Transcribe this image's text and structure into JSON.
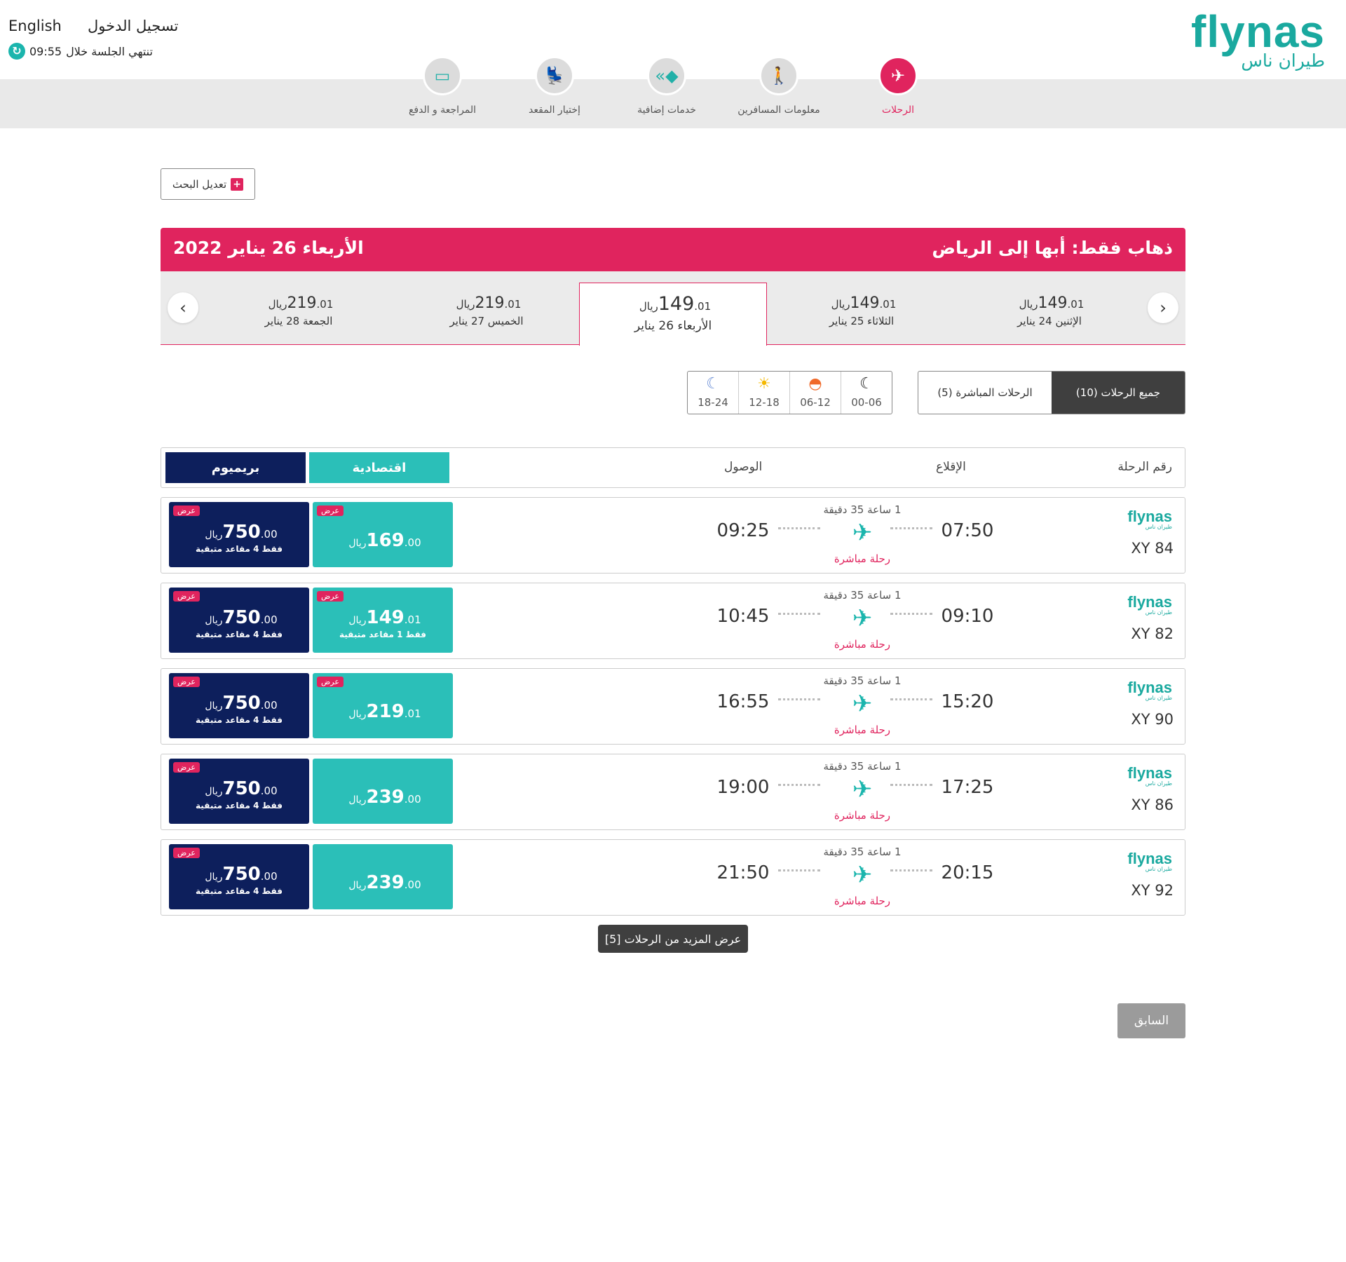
{
  "header": {
    "language_link": "English",
    "login_link": "تسجيل الدخول",
    "session_text": "تنتهي الجلسة خلال",
    "session_time": "09:55",
    "logo_en": "flynas",
    "logo_ar": "طيران ناس"
  },
  "steps": [
    {
      "label": "الرحلات",
      "icon": "plane-icon",
      "active": true
    },
    {
      "label": "معلومات المسافرين",
      "icon": "traveler-icon"
    },
    {
      "label": "خدمات إضافية",
      "icon": "extras-icon"
    },
    {
      "label": "إختيار المقعد",
      "icon": "seat-icon"
    },
    {
      "label": "المراجعة و الدفع",
      "icon": "payment-icon"
    }
  ],
  "modify_search": "تعديل البحث",
  "banner": {
    "route": "ذهاب فقط: أبها إلى الرياض",
    "date": "الأربعاء 26 يناير 2022"
  },
  "date_strip": [
    {
      "day": "الإثنين 24 يناير",
      "price": "149",
      "dec": ".01",
      "currency": "ريال"
    },
    {
      "day": "الثلاثاء 25 يناير",
      "price": "149",
      "dec": ".01",
      "currency": "ريال"
    },
    {
      "day": "الأربعاء 26 يناير",
      "price": "149",
      "dec": ".01",
      "currency": "ريال",
      "selected": true
    },
    {
      "day": "الخميس 27 يناير",
      "price": "219",
      "dec": ".01",
      "currency": "ريال"
    },
    {
      "day": "الجمعة 28 يناير",
      "price": "219",
      "dec": ".01",
      "currency": "ريال"
    }
  ],
  "time_filters": [
    "00-06",
    "06-12",
    "12-18",
    "18-24"
  ],
  "type_tabs": {
    "all": "جميع الرحلات (10)",
    "direct": "الرحلات المباشرة (5)"
  },
  "table_header": {
    "flight_no": "رقم الرحلة",
    "departure": "الإقلاع",
    "arrival": "الوصول",
    "economy": "اقتصادية",
    "premium": "بريميوم"
  },
  "flights": [
    {
      "no": "XY 84",
      "dep": "07:50",
      "arr": "09:25",
      "duration": "1 ساعة 35 دقيقة",
      "type": "رحلة مباشرة",
      "eco": {
        "amt": "169",
        "dec": ".00",
        "cur": "ريال",
        "badge": "عرض",
        "left": ""
      },
      "prem": {
        "amt": "750",
        "dec": ".00",
        "cur": "ريال",
        "badge": "عرض",
        "left": "فقط 4 مقاعد متبقية"
      }
    },
    {
      "no": "XY 82",
      "dep": "09:10",
      "arr": "10:45",
      "duration": "1 ساعة 35 دقيقة",
      "type": "رحلة مباشرة",
      "eco": {
        "amt": "149",
        "dec": ".01",
        "cur": "ريال",
        "badge": "عرض",
        "left": "فقط 1 مقاعد متبقية"
      },
      "prem": {
        "amt": "750",
        "dec": ".00",
        "cur": "ريال",
        "badge": "عرض",
        "left": "فقط 4 مقاعد متبقية"
      }
    },
    {
      "no": "XY 90",
      "dep": "15:20",
      "arr": "16:55",
      "duration": "1 ساعة 35 دقيقة",
      "type": "رحلة مباشرة",
      "eco": {
        "amt": "219",
        "dec": ".01",
        "cur": "ريال",
        "badge": "عرض",
        "left": ""
      },
      "prem": {
        "amt": "750",
        "dec": ".00",
        "cur": "ريال",
        "badge": "عرض",
        "left": "فقط 4 مقاعد متبقية"
      }
    },
    {
      "no": "XY 86",
      "dep": "17:25",
      "arr": "19:00",
      "duration": "1 ساعة 35 دقيقة",
      "type": "رحلة مباشرة",
      "eco": {
        "amt": "239",
        "dec": ".00",
        "cur": "ريال",
        "badge": "",
        "left": ""
      },
      "prem": {
        "amt": "750",
        "dec": ".00",
        "cur": "ريال",
        "badge": "عرض",
        "left": "فقط 4 مقاعد متبقية"
      }
    },
    {
      "no": "XY 92",
      "dep": "20:15",
      "arr": "21:50",
      "duration": "1 ساعة 35 دقيقة",
      "type": "رحلة مباشرة",
      "eco": {
        "amt": "239",
        "dec": ".00",
        "cur": "ريال",
        "badge": "",
        "left": ""
      },
      "prem": {
        "amt": "750",
        "dec": ".00",
        "cur": "ريال",
        "badge": "عرض",
        "left": "فقط 4 مقاعد متبقية"
      }
    }
  ],
  "more_button": "عرض المزيد من الرحلات [5]",
  "prev_button": "السابق",
  "colors": {
    "brand_pink": "#e0245e",
    "brand_teal": "#1aa99f",
    "economy": "#2bbfb8",
    "premium": "#0d1f5c"
  }
}
